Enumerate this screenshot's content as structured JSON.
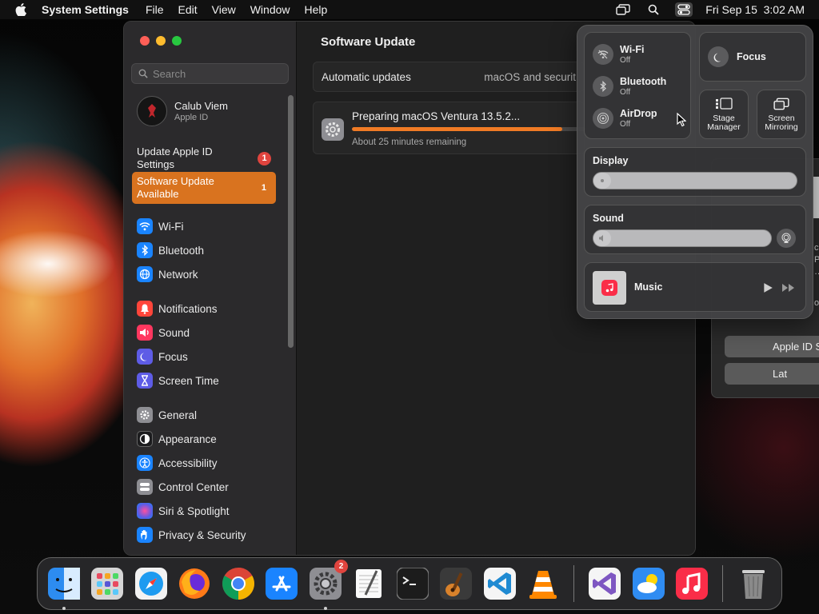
{
  "menubar": {
    "app_name": "System Settings",
    "menus": [
      "File",
      "Edit",
      "View",
      "Window",
      "Help"
    ],
    "datetime": "Fri Sep 15  3:02 AM"
  },
  "sidebar": {
    "search_placeholder": "Search",
    "account": {
      "name": "Calub Viem",
      "sub": "Apple ID"
    },
    "apple_id_notice": {
      "label": "Update Apple ID Settings",
      "badge": "1"
    },
    "update_notice": {
      "label": "Software Update Available",
      "badge": "1"
    },
    "groups": [
      [
        {
          "label": "Wi-Fi",
          "icon": "wifi-icon",
          "color": "#1a84ff"
        },
        {
          "label": "Bluetooth",
          "icon": "bluetooth-icon",
          "color": "#1a84ff"
        },
        {
          "label": "Network",
          "icon": "globe-icon",
          "color": "#1a84ff"
        }
      ],
      [
        {
          "label": "Notifications",
          "icon": "bell-icon",
          "color": "#ff453a"
        },
        {
          "label": "Sound",
          "icon": "speaker-icon",
          "color": "#ff375f"
        },
        {
          "label": "Focus",
          "icon": "moon-icon",
          "color": "#5e5ce6"
        },
        {
          "label": "Screen Time",
          "icon": "hourglass-icon",
          "color": "#5e5ce6"
        }
      ],
      [
        {
          "label": "General",
          "icon": "gear-icon",
          "color": "#8e8e93"
        },
        {
          "label": "Appearance",
          "icon": "appearance-icon",
          "color": "#1c1c1e"
        },
        {
          "label": "Accessibility",
          "icon": "accessibility-icon",
          "color": "#1a84ff"
        },
        {
          "label": "Control Center",
          "icon": "toggles-icon",
          "color": "#8e8e93"
        },
        {
          "label": "Siri & Spotlight",
          "icon": "siri-icon",
          "color": "#bf5af2"
        },
        {
          "label": "Privacy & Security",
          "icon": "hand-icon",
          "color": "#1a84ff"
        }
      ]
    ]
  },
  "content": {
    "title": "Software Update",
    "auto_updates": {
      "label": "Automatic updates",
      "value": "macOS and securit"
    },
    "progress": {
      "title": "Preparing macOS Ventura 13.5.2...",
      "remaining": "About 25 minutes remaining",
      "fraction": 0.9
    }
  },
  "control_center": {
    "wifi": {
      "title": "Wi-Fi",
      "status": "Off"
    },
    "bluetooth": {
      "title": "Bluetooth",
      "status": "Off"
    },
    "airdrop": {
      "title": "AirDrop",
      "status": "Off"
    },
    "focus": "Focus",
    "stage_manager": "Stage Manager",
    "screen_mirroring": "Screen Mirroring",
    "display": {
      "label": "Display",
      "level": 0.05
    },
    "sound": {
      "label": "Sound",
      "level": 0.05
    },
    "music": "Music"
  },
  "bg_window": {
    "button_apple_id": "Apple ID S",
    "button_later": "Lat",
    "text_lines": [
      "c",
      "P",
      "…",
      "o"
    ]
  },
  "dock": {
    "apps": [
      {
        "name": "finder",
        "color": "#2d8cf0",
        "glyph": "",
        "running": true
      },
      {
        "name": "launchpad",
        "color": "#cfcfcf",
        "glyph": "",
        "running": false
      },
      {
        "name": "safari",
        "color": "#1e9bf0",
        "glyph": "",
        "running": false
      },
      {
        "name": "firefox",
        "color": "#ff7a18",
        "glyph": "",
        "running": false
      },
      {
        "name": "chrome",
        "color": "#f2f2f2",
        "glyph": "",
        "running": false
      },
      {
        "name": "app-store",
        "color": "#1a84ff",
        "glyph": "",
        "running": false
      },
      {
        "name": "system-settings",
        "color": "#8e8e93",
        "glyph": "",
        "running": true,
        "badge": "2"
      },
      {
        "name": "textedit",
        "color": "#efefef",
        "glyph": "",
        "running": false
      },
      {
        "name": "terminal",
        "color": "#1c1c1c",
        "glyph": ">_",
        "running": false
      },
      {
        "name": "garageband",
        "color": "#3a3a3a",
        "glyph": "",
        "running": false
      },
      {
        "name": "vscode",
        "color": "#f5f5f5",
        "glyph": "",
        "running": false
      },
      {
        "name": "vlc",
        "color": "#2a2a2a",
        "glyph": "",
        "running": false
      },
      {
        "name": "visual-studio",
        "color": "#f5f5f5",
        "glyph": "",
        "running": false
      },
      {
        "name": "weather",
        "color": "#2f8cf2",
        "glyph": "",
        "running": false
      },
      {
        "name": "music",
        "color": "#fa2d48",
        "glyph": "",
        "running": false
      },
      {
        "name": "trash",
        "color": "transparent",
        "glyph": "",
        "running": false
      }
    ]
  }
}
